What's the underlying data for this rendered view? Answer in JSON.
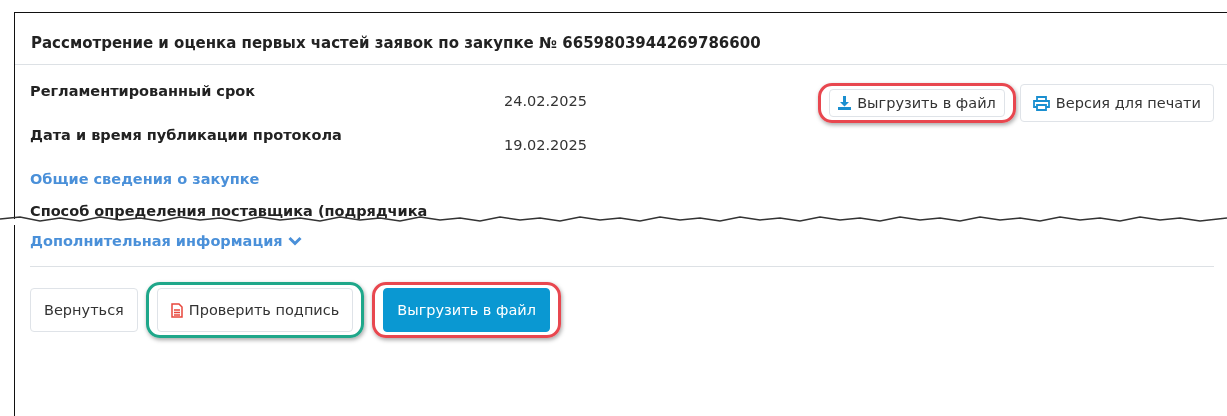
{
  "title": "Рассмотрение и оценка первых частей заявок по закупке № 6659803944269786600",
  "fields": [
    {
      "label": "Регламентированный срок",
      "value": "24.02.2025"
    },
    {
      "label": "Дата и время публикации протокола",
      "value": "19.02.2025"
    }
  ],
  "top_buttons": [
    {
      "kind": "download",
      "label": "Выгрузить в файл",
      "color": "#e8474f"
    },
    {
      "kind": "print",
      "label": "Версия для печати"
    }
  ],
  "general_link": "Общие сведения о закупке",
  "cut_label": "Способ определения поставщика (подрядчика",
  "more_link": {
    "label": "Дополнительная информация",
    "expanded": false
  },
  "bottom_buttons": [
    {
      "kind": "plain",
      "label": "Вернуться"
    },
    {
      "kind": "document",
      "label": "Проверить подпись",
      "color": "#1fa78a"
    },
    {
      "kind": "primary",
      "label": "Выгрузить в файл",
      "color": "#e8474f"
    }
  ]
}
